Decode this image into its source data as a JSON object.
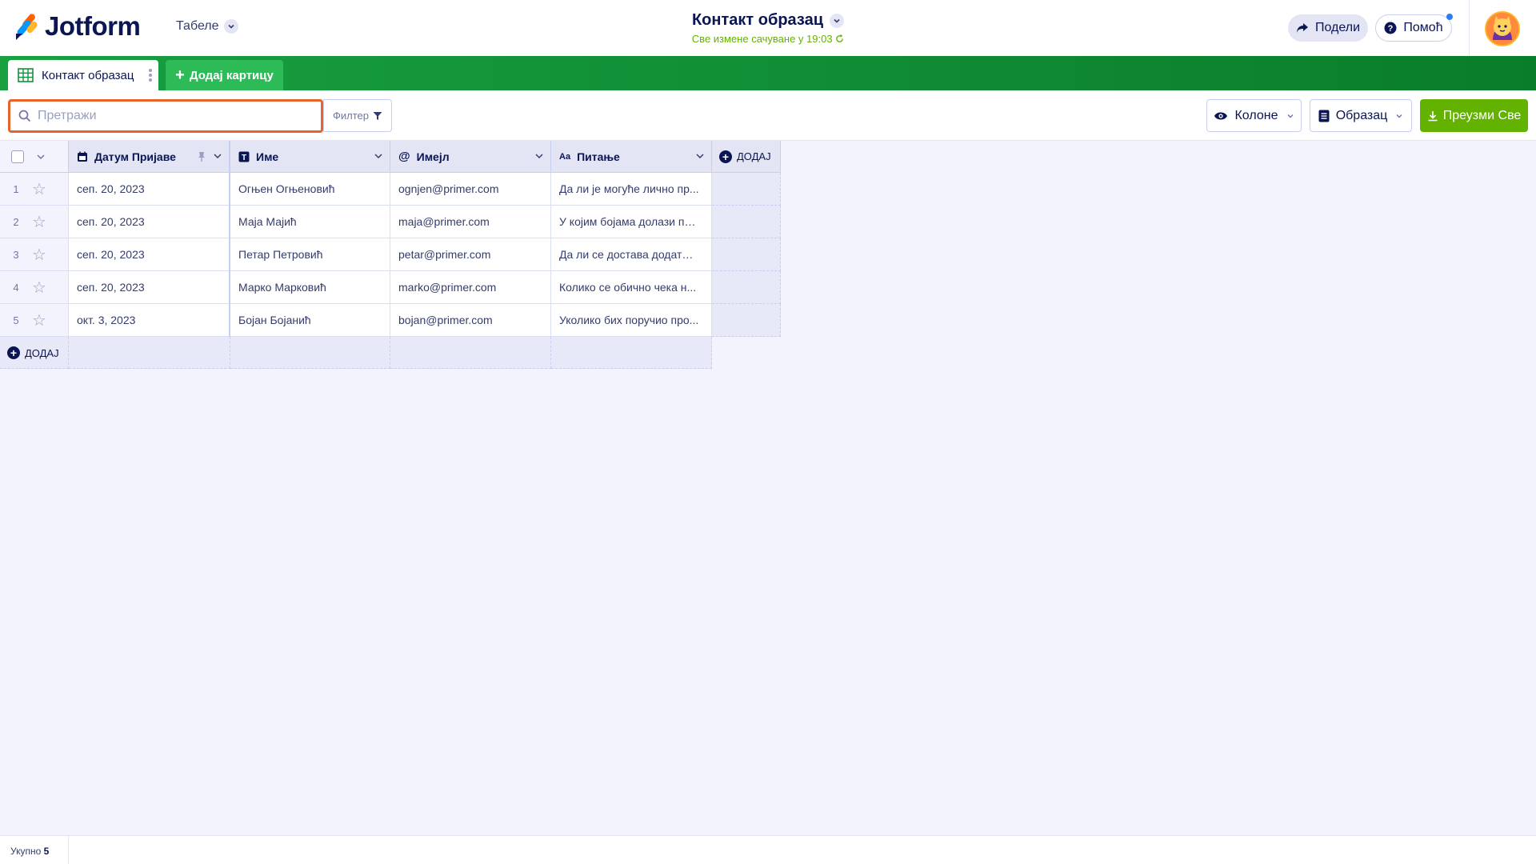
{
  "header": {
    "logo_text": "Jotform",
    "tables_label": "Табеле",
    "form_title": "Контакт образац",
    "saved_status": "Све измене сачуване у 19:03",
    "share_label": "Подели",
    "help_label": "Помоћ"
  },
  "tabs": {
    "active_label": "Контакт образац",
    "add_label": "Додај картицу"
  },
  "toolbar": {
    "search_placeholder": "Претражи",
    "filter_label": "Филтер",
    "columns_label": "Колоне",
    "form_label": "Образац",
    "download_label": "Преузми Све"
  },
  "columns": [
    {
      "label": "Датум Пријаве",
      "icon": "calendar-icon"
    },
    {
      "label": "Име",
      "icon": "text-icon"
    },
    {
      "label": "Имејл",
      "icon": "at-icon"
    },
    {
      "label": "Питање",
      "icon": "textarea-icon"
    }
  ],
  "add_column_label": "ДОДАЈ",
  "rows": [
    {
      "num": "1",
      "date": "сеп. 20, 2023",
      "name": "Огњен Огњеновић",
      "email": "ognjen@primer.com",
      "question": "Да ли је могуће лично пр..."
    },
    {
      "num": "2",
      "date": "сеп. 20, 2023",
      "name": "Маја Мајић",
      "email": "maja@primer.com",
      "question": "У којим бојама долази пр..."
    },
    {
      "num": "3",
      "date": "сеп. 20, 2023",
      "name": "Петар Петровић",
      "email": "petar@primer.com",
      "question": "Да ли се достава додатно ..."
    },
    {
      "num": "4",
      "date": "сеп. 20, 2023",
      "name": "Марко Марковић",
      "email": "marko@primer.com",
      "question": "Колико се обично чека н..."
    },
    {
      "num": "5",
      "date": "окт. 3, 2023",
      "name": "Бојан Бојанић",
      "email": "bojan@primer.com",
      "question": "Уколико бих поручио про..."
    }
  ],
  "add_row_label": "ДОДАЈ",
  "footer": {
    "total_label": "Укупно",
    "total_value": "5"
  },
  "colors": {
    "brand_navy": "#0a1551",
    "green_bar": "#0a7d2a",
    "download_green": "#64b200",
    "search_focus": "#e8632b"
  }
}
